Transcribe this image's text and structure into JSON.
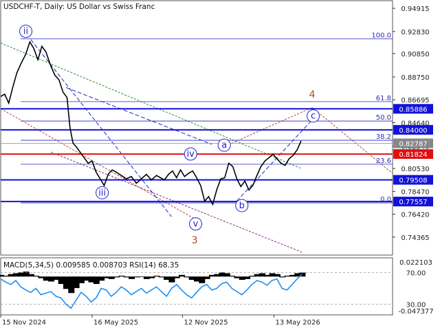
{
  "chart_data": {
    "type": "line",
    "title": "USDCHF-T, Daily:  US Dollar vs Swiss Franc",
    "price_axis": {
      "ylim": [
        0.7275,
        0.956
      ],
      "tick_labels": [
        "0.94915",
        "0.92830",
        "0.90850",
        "0.88750",
        "0.86695",
        "0.84640",
        "0.82540",
        "0.80530",
        "0.78470",
        "0.76420",
        "0.74365"
      ],
      "tick_values": [
        0.94915,
        0.9283,
        0.9085,
        0.8875,
        0.86695,
        0.8464,
        0.8254,
        0.8053,
        0.7847,
        0.7642,
        0.74365
      ]
    },
    "x_axis": {
      "tick_labels": [
        "15 Nov 2024",
        "16 May 2025",
        "12 Nov 2025",
        "13 May 2026"
      ],
      "tick_positions": [
        0,
        182,
        362,
        544
      ],
      "xlim": [
        0,
        780
      ]
    },
    "fib_levels": [
      {
        "label": "100.0",
        "value": 0.9218
      },
      {
        "label": "61.8",
        "value": 0.8653
      },
      {
        "label": "50.0",
        "value": 0.8479
      },
      {
        "label": "38.2",
        "value": 0.8306
      },
      {
        "label": "23.6",
        "value": 0.8091
      },
      {
        "label": "0.0",
        "value": 0.7744
      }
    ],
    "price_levels": [
      {
        "label": "0.85886",
        "value": 0.85886,
        "color": "#1212d8",
        "bg": "#1212d8"
      },
      {
        "label": "0.84000",
        "value": 0.84,
        "color": "#1212d8",
        "bg": "#1212d8"
      },
      {
        "label": "0.82787",
        "value": 0.82787,
        "color": "#888888",
        "bg": "#888888"
      },
      {
        "label": "0.81824",
        "value": 0.81824,
        "color": "#e01010",
        "bg": "#e01010"
      },
      {
        "label": "0.79508",
        "value": 0.79508,
        "color": "#1212d8",
        "bg": "#1212d8"
      },
      {
        "label": "0.77557",
        "value": 0.77557,
        "color": "#1212d8",
        "bg": "#1212d8"
      }
    ],
    "price_series": {
      "name": "USDCHF-T",
      "x": [
        0,
        8,
        16,
        24,
        32,
        40,
        50,
        58,
        66,
        74,
        82,
        90,
        100,
        108,
        116,
        124,
        132,
        138,
        144,
        150,
        158,
        166,
        174,
        182,
        190,
        198,
        206,
        214,
        222,
        230,
        240,
        250,
        260,
        270,
        280,
        290,
        300,
        310,
        318,
        326,
        334,
        342,
        350,
        358,
        366,
        374,
        382,
        390,
        398,
        406,
        414,
        422,
        430,
        438,
        446,
        454,
        462,
        470,
        478,
        486,
        494,
        502,
        510,
        518,
        526,
        534,
        542,
        550,
        558,
        566,
        574,
        582,
        590,
        598
      ],
      "values": [
        0.87,
        0.872,
        0.864,
        0.878,
        0.891,
        0.899,
        0.908,
        0.919,
        0.913,
        0.903,
        0.915,
        0.91,
        0.897,
        0.889,
        0.885,
        0.874,
        0.869,
        0.842,
        0.828,
        0.825,
        0.82,
        0.815,
        0.81,
        0.812,
        0.802,
        0.796,
        0.79,
        0.8,
        0.804,
        0.802,
        0.799,
        0.796,
        0.798,
        0.792,
        0.796,
        0.8,
        0.795,
        0.799,
        0.797,
        0.795,
        0.8,
        0.803,
        0.797,
        0.804,
        0.798,
        0.801,
        0.803,
        0.797,
        0.79,
        0.776,
        0.78,
        0.773,
        0.786,
        0.796,
        0.797,
        0.81,
        0.807,
        0.796,
        0.789,
        0.794,
        0.786,
        0.79,
        0.799,
        0.807,
        0.812,
        0.815,
        0.818,
        0.814,
        0.81,
        0.808,
        0.814,
        0.817,
        0.822,
        0.83
      ]
    },
    "wave_labels": [
      {
        "text": "ii",
        "x": 50,
        "value": 0.9285,
        "circled": true
      },
      {
        "text": "iii",
        "x": 202,
        "value": 0.7835,
        "circled": true
      },
      {
        "text": "iv",
        "x": 378,
        "value": 0.8183,
        "circled": true
      },
      {
        "text": "v",
        "x": 388,
        "value": 0.7555,
        "circled": true
      },
      {
        "text": "a",
        "x": 445,
        "value": 0.8262,
        "circled": true
      },
      {
        "text": "b",
        "x": 480,
        "value": 0.772,
        "circled": true
      },
      {
        "text": "c",
        "x": 622,
        "value": 0.8525,
        "circled": true
      },
      {
        "text": "3",
        "x": 386,
        "value": 0.741,
        "circled": false
      },
      {
        "text": "4",
        "x": 620,
        "value": 0.872,
        "circled": false
      }
    ],
    "indicator": {
      "title": "MACD(5,34,5) 0.009585 0.008703 RSI(14) 68.35",
      "tick_labels": [
        "0.022103",
        "70.00",
        "30.00",
        "-0.047377"
      ],
      "tick_values": [
        0.022103,
        70,
        30,
        -0.047377
      ],
      "rsi_levels": [
        70,
        30
      ],
      "rsi": {
        "x": [
          0,
          10,
          20,
          30,
          40,
          50,
          60,
          70,
          80,
          90,
          100,
          110,
          120,
          130,
          140,
          150,
          160,
          170,
          180,
          190,
          200,
          210,
          220,
          230,
          240,
          250,
          260,
          270,
          280,
          290,
          300,
          310,
          320,
          330,
          340,
          350,
          360,
          370,
          380,
          390,
          400,
          410,
          420,
          430,
          440,
          450,
          460,
          470,
          480,
          490,
          500,
          510,
          520,
          530,
          540,
          550,
          560,
          570,
          580,
          590,
          600
        ],
        "values": [
          62,
          58,
          55,
          60,
          52,
          48,
          45,
          50,
          42,
          44,
          46,
          40,
          38,
          30,
          25,
          35,
          45,
          40,
          33,
          38,
          50,
          48,
          40,
          45,
          52,
          48,
          42,
          46,
          50,
          44,
          48,
          52,
          46,
          40,
          50,
          55,
          48,
          42,
          38,
          45,
          52,
          55,
          48,
          50,
          56,
          58,
          50,
          46,
          42,
          48,
          55,
          60,
          58,
          54,
          60,
          62,
          50,
          48,
          55,
          62,
          68
        ]
      },
      "macd": {
        "x": [
          0,
          10,
          20,
          30,
          40,
          50,
          60,
          70,
          80,
          90,
          100,
          110,
          120,
          130,
          140,
          150,
          160,
          170,
          180,
          190,
          200,
          210,
          220,
          230,
          240,
          250,
          260,
          270,
          280,
          290,
          300,
          310,
          320,
          330,
          340,
          350,
          360,
          370,
          380,
          390,
          400,
          410,
          420,
          430,
          440,
          450,
          460,
          470,
          480,
          490,
          500,
          510,
          520,
          530,
          540,
          550,
          560,
          570,
          580,
          590,
          600
        ],
        "values": [
          0.004,
          0.002,
          0.006,
          0.008,
          0.01,
          0.012,
          0.006,
          0.002,
          -0.004,
          -0.01,
          -0.012,
          -0.008,
          -0.018,
          -0.03,
          -0.04,
          -0.028,
          -0.016,
          -0.01,
          -0.014,
          -0.018,
          -0.01,
          -0.004,
          -0.006,
          -0.002,
          0.002,
          -0.002,
          -0.006,
          -0.002,
          0.0,
          -0.006,
          -0.004,
          0.002,
          -0.002,
          -0.008,
          -0.014,
          -0.004,
          0.004,
          -0.002,
          -0.008,
          -0.012,
          -0.016,
          -0.006,
          0.004,
          0.006,
          0.01,
          0.008,
          0.002,
          -0.004,
          -0.008,
          -0.006,
          0.002,
          0.006,
          0.008,
          0.004,
          0.008,
          0.006,
          -0.002,
          0.002,
          0.004,
          0.008,
          0.0096
        ]
      }
    },
    "colors": {
      "price": "#000000",
      "fib": "#2323c8",
      "rsi": "#1f8ff2",
      "macd": "#000000",
      "trend_green": "#2f8a2f",
      "trend_purple": "#7a2a7a",
      "trend_red": "#b6422c"
    }
  }
}
